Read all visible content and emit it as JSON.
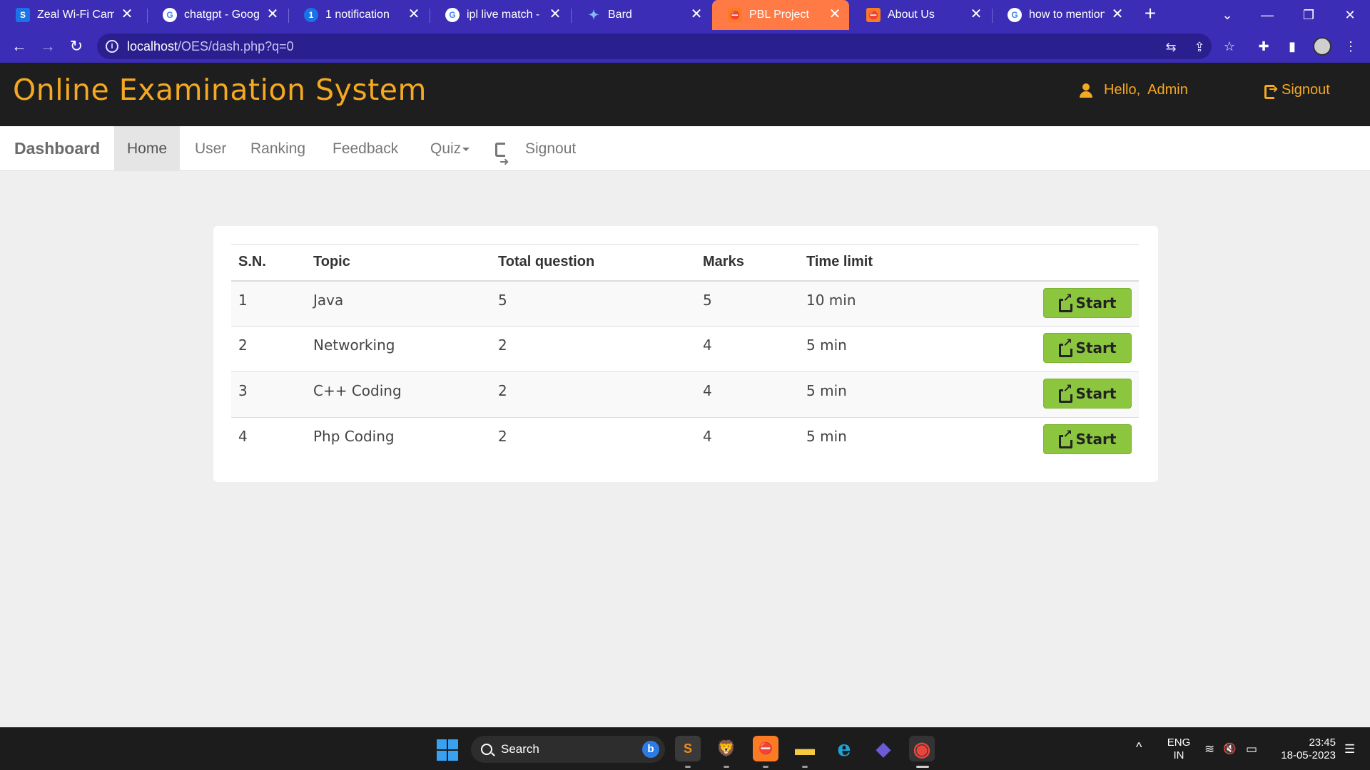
{
  "browser": {
    "tabs": [
      {
        "title": "Zeal Wi-Fi Campu",
        "icon": "zeal-s-icon",
        "icon_char": "S",
        "icon_color": "#1a73e8"
      },
      {
        "title": "chatgpt - Google",
        "icon": "google-icon",
        "icon_char": "G",
        "icon_color": "#ffffff"
      },
      {
        "title": "1 notification",
        "icon": "notification-icon",
        "icon_char": "1",
        "icon_color": "#1a73e8"
      },
      {
        "title": "ipl live match - Go",
        "icon": "google-icon",
        "icon_char": "G",
        "icon_color": "#ffffff"
      },
      {
        "title": "Bard",
        "icon": "bard-sparkle-icon",
        "icon_char": "✦",
        "icon_color": "#4285f4"
      },
      {
        "title": "PBL Project",
        "icon": "xampp-icon",
        "icon_char": "⛔",
        "icon_color": "#fb7a24",
        "active": true
      },
      {
        "title": "About Us",
        "icon": "xampp-icon",
        "icon_char": "⛔",
        "icon_color": "#fb7a24"
      },
      {
        "title": "how to mention t",
        "icon": "google-icon",
        "icon_char": "G",
        "icon_color": "#ffffff"
      }
    ],
    "tab_close_glyph": "✕",
    "new_tab_glyph": "+",
    "window_controls": {
      "tab_search": "⌄",
      "minimize": "—",
      "restore": "❐",
      "close": "✕"
    },
    "nav": {
      "back": "←",
      "forward": "→",
      "reload": "↻"
    },
    "url_host": "localhost",
    "url_path": "/OES/dash.php?q=0",
    "info_glyph": "i",
    "omnibox_icons": {
      "translate": "⇆",
      "share": "⇪",
      "bookmark": "☆"
    },
    "toolbar_icons": {
      "extensions": "✚",
      "side_panel": "▮",
      "menu": "⋮"
    }
  },
  "site": {
    "title": "Online Examination System",
    "hello_label": "Hello,",
    "user_name": "Admin",
    "header_signout": "Signout",
    "accent_color": "#f5a821"
  },
  "nav": {
    "brand": "Dashboard",
    "items": [
      {
        "label": "Home",
        "active": true
      },
      {
        "label": "User"
      },
      {
        "label": "Ranking"
      },
      {
        "label": "Feedback"
      },
      {
        "label": "Quiz"
      }
    ],
    "signout": "Signout"
  },
  "quiz_table": {
    "headers": [
      "S.N.",
      "Topic",
      "Total question",
      "Marks",
      "Time limit"
    ],
    "rows": [
      {
        "sn": "1",
        "topic": "Java",
        "total_question": "5",
        "marks": "5",
        "time_limit": "10 min"
      },
      {
        "sn": "2",
        "topic": "Networking",
        "total_question": "2",
        "marks": "4",
        "time_limit": "5 min"
      },
      {
        "sn": "3",
        "topic": "C++ Coding",
        "total_question": "2",
        "marks": "4",
        "time_limit": "5 min"
      },
      {
        "sn": "4",
        "topic": "Php Coding",
        "total_question": "2",
        "marks": "4",
        "time_limit": "5 min"
      }
    ],
    "start_label": "Start",
    "start_color": "#8cc63f"
  },
  "taskbar": {
    "search_label": "Search",
    "bing_glyph": "b",
    "apps": [
      {
        "name": "sublime-text-icon",
        "glyph": "S",
        "color": "#f08c1a"
      },
      {
        "name": "brave-icon",
        "glyph": "🦁",
        "color": "#fb542b"
      },
      {
        "name": "xampp-icon",
        "glyph": "⛔",
        "color": "#fb7a24"
      },
      {
        "name": "file-explorer-icon",
        "glyph": "▬",
        "color": "#f7c940"
      },
      {
        "name": "edge-icon",
        "glyph": "e",
        "color": "#1fa2d8"
      },
      {
        "name": "copilot-icon",
        "glyph": "◆",
        "color": "#6b5bd6"
      },
      {
        "name": "chrome-icon",
        "glyph": "◉",
        "color": "#e8453c"
      }
    ],
    "tray_chevron": "^",
    "language_line1": "ENG",
    "language_line2": "IN",
    "wifi_glyph": "≋",
    "volume_glyph": "🔇",
    "battery_glyph": "▭",
    "time": "23:45",
    "date": "18-05-2023",
    "notification_glyph": "☰"
  }
}
